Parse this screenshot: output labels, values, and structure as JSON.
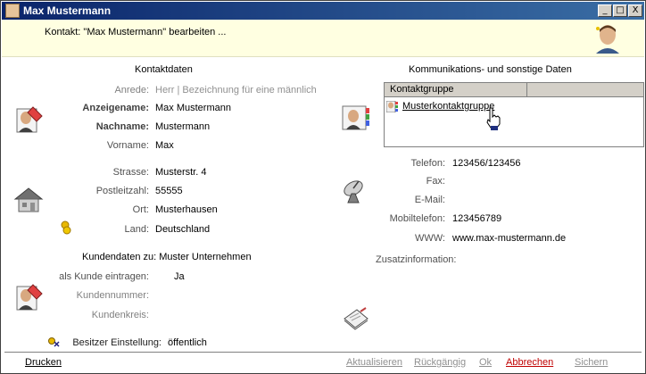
{
  "window": {
    "title": "Max Mustermann"
  },
  "titlebar_buttons": {
    "minimize": "_",
    "maximize": "□",
    "close": "X"
  },
  "header": {
    "text": "Kontakt: \"Max Mustermann\" bearbeiten ..."
  },
  "left": {
    "section_title": "Kontaktdaten",
    "anrede_label": "Anrede:",
    "anrede_value": "Herr | Bezeichnung für eine männlich",
    "anzeigename_label": "Anzeigename:",
    "anzeigename_value": "Max Mustermann",
    "nachname_label": "Nachname:",
    "nachname_value": "Mustermann",
    "vorname_label": "Vorname:",
    "vorname_value": "Max",
    "strasse_label": "Strasse:",
    "strasse_value": "Musterstr. 4",
    "plz_label": "Postleitzahl:",
    "plz_value": "55555",
    "ort_label": "Ort:",
    "ort_value": "Musterhausen",
    "land_label": "Land:",
    "land_value": "Deutschland",
    "kunden_title": "Kundendaten zu: Muster Unternehmen",
    "kunde_label": "als Kunde eintragen:",
    "kunde_value": "Ja",
    "kundennummer_label": "Kundennummer:",
    "kundenkreis_label": "Kundenkreis:",
    "besitzer_label": "Besitzer Einstellung:",
    "besitzer_value": "öffentlich"
  },
  "right": {
    "section_title": "Kommunikations- und sonstige Daten",
    "group_header": "Kontaktgruppe",
    "group_item": "Musterkontaktgruppe",
    "telefon_label": "Telefon:",
    "telefon_value": "123456/123456",
    "fax_label": "Fax:",
    "email_label": "E-Mail:",
    "mobil_label": "Mobiltelefon:",
    "mobil_value": "123456789",
    "www_label": "WWW:",
    "www_value": "www.max-mustermann.de",
    "zusatz_label": "Zusatzinformation:"
  },
  "footer": {
    "drucken": "Drucken",
    "aktualisieren": "Aktualisieren",
    "rueckgaengig": "Rückgängig",
    "ok": "Ok",
    "abbrechen": "Abbrechen",
    "sichern": "Sichern"
  },
  "colors": {
    "titlebar": "#0a246a",
    "header_bg": "#ffffe1",
    "cancel": "#c00000",
    "disabled": "#909090"
  }
}
